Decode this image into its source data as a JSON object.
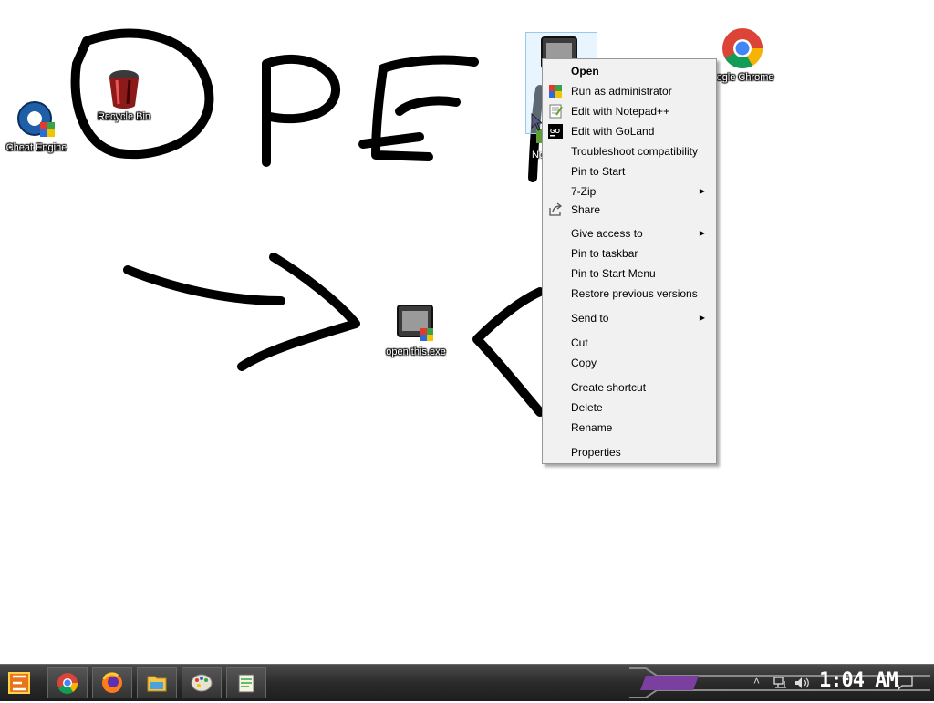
{
  "desktop": {
    "handwriting": "OPEN",
    "icons": [
      {
        "label": "Cheat Engine",
        "icon": "cheat-engine-icon"
      },
      {
        "label": "Recycle Bin",
        "icon": "recycle-bin-icon"
      },
      {
        "label": "open this.exe",
        "icon": "exe-app-icon"
      },
      {
        "label": "oogle Chrome",
        "icon": "chrome-icon"
      },
      {
        "label": "No",
        "icon": "notepad-shortcut-icon"
      }
    ]
  },
  "context_menu": {
    "items": [
      {
        "label": "Open",
        "bold": true
      },
      {
        "label": "Run as administrator",
        "icon": "shield-icon"
      },
      {
        "label": "Edit with Notepad++",
        "icon": "notepadpp-icon"
      },
      {
        "label": "Edit with GoLand",
        "icon": "goland-icon"
      },
      {
        "label": "Troubleshoot compatibility"
      },
      {
        "label": "Pin to Start"
      },
      {
        "label": "7-Zip",
        "submenu": true
      },
      {
        "label": "Share",
        "icon": "share-icon"
      },
      {
        "label": "Give access to",
        "submenu": true
      },
      {
        "label": "Pin to taskbar"
      },
      {
        "label": "Pin to Start Menu"
      },
      {
        "label": "Restore previous versions"
      },
      {
        "label": "Send to",
        "submenu": true
      },
      {
        "label": "Cut"
      },
      {
        "label": "Copy"
      },
      {
        "label": "Create shortcut"
      },
      {
        "label": "Delete"
      },
      {
        "label": "Rename"
      },
      {
        "label": "Properties"
      }
    ]
  },
  "taskbar": {
    "buttons": [
      "start-icon",
      "chrome-icon",
      "firefox-icon",
      "file-explorer-icon",
      "paint-icon",
      "notepad-icon"
    ],
    "tray_icons": [
      "chevron-up-icon",
      "network-icon",
      "volume-icon"
    ],
    "clock": "1:04 AM",
    "notification_icon": "action-center-icon"
  },
  "colors": {
    "accent": "#7b3fa0",
    "menu_bg": "#f1f1f1",
    "taskbar": "#2b2b2b"
  }
}
